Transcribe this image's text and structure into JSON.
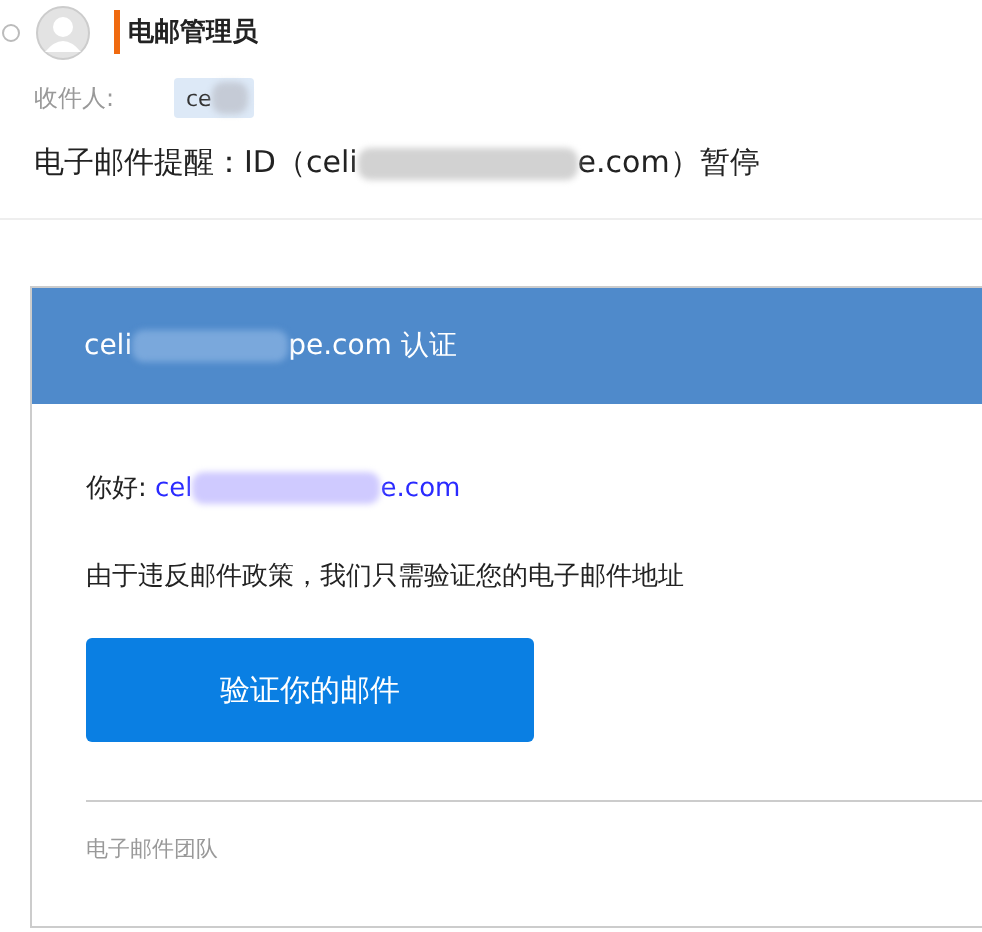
{
  "sender": {
    "name": "电邮管理员"
  },
  "recipient": {
    "label": "收件人:",
    "chip": "ce"
  },
  "subject": {
    "before": "电子邮件提醒：ID（celi",
    "after": "e.com）暂停"
  },
  "card": {
    "title_before": "celi",
    "title_after": "pe.com 认证",
    "greeting": "你好:",
    "email_before": "cel",
    "email_after": "e.com",
    "message": "由于违反邮件政策，我们只需验证您的电子邮件地址",
    "button": "验证你的邮件",
    "signature": "电子邮件团队"
  }
}
